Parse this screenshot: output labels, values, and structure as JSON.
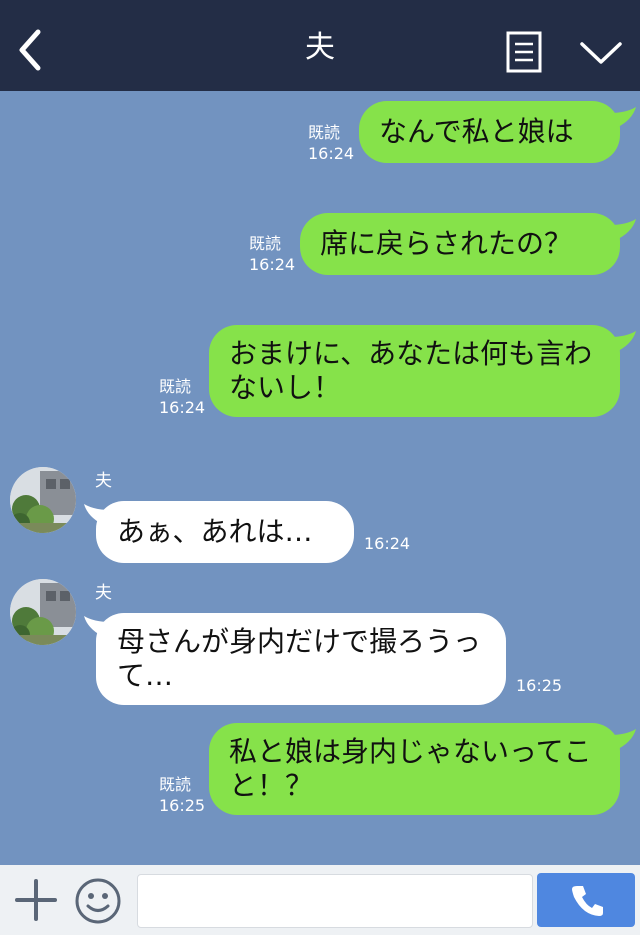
{
  "header": {
    "title": "夫"
  },
  "messages": [
    {
      "text": "なんで私と娘は",
      "read": "既読",
      "time": "16:24"
    },
    {
      "text": "席に戻らされたの？",
      "read": "既読",
      "time": "16:24"
    },
    {
      "text": "おまけに、あなたは何も言わないし！",
      "read": "既読",
      "time": "16:24"
    },
    {
      "sender": "夫",
      "text": "あぁ、あれは…",
      "time": "16:24"
    },
    {
      "sender": "夫",
      "text": "母さんが身内だけで撮ろうって…",
      "time": "16:25"
    },
    {
      "text": "私と娘は身内じゃないってこと！？",
      "read": "既読",
      "time": "16:25"
    }
  ],
  "footer": {
    "input_placeholder": ""
  },
  "colors": {
    "header": "#232d46",
    "background": "#7293c0",
    "outgoing": "#86e24a",
    "incoming": "#ffffff",
    "call_button": "#4f87e0"
  },
  "icons": [
    "back-arrow-icon",
    "notes-icon",
    "chevron-down-icon",
    "plus-icon",
    "emoji-icon",
    "phone-icon"
  ]
}
